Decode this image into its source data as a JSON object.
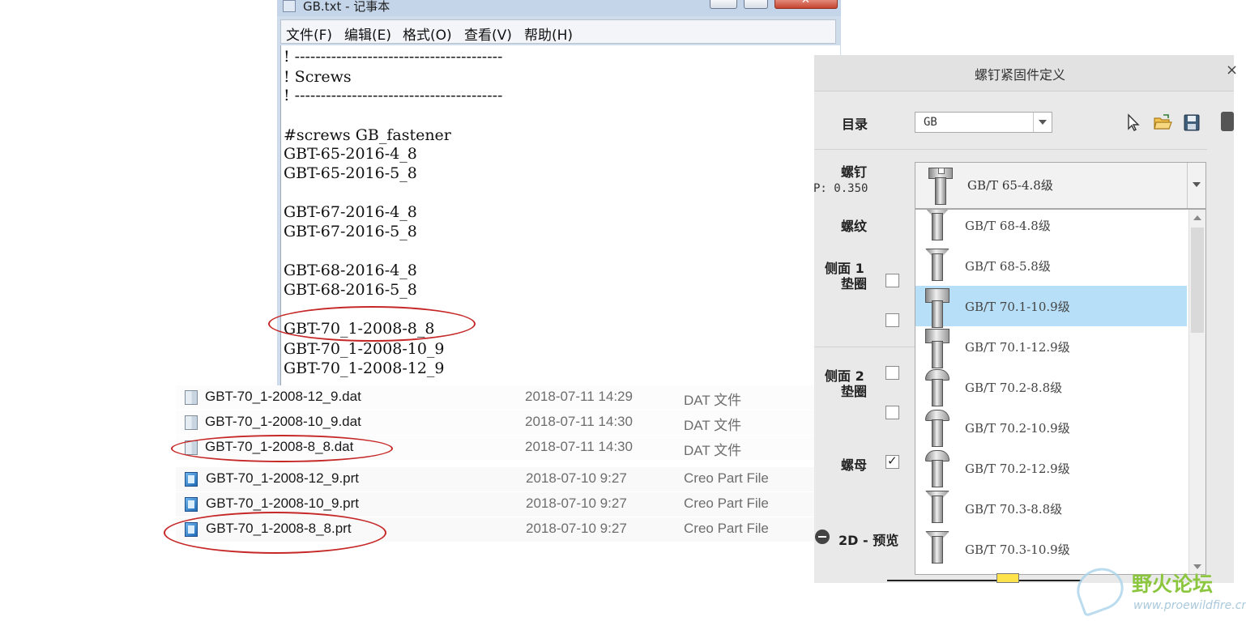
{
  "notepad": {
    "title": "GB.txt - 记事本",
    "menu": [
      "文件(F)",
      "编辑(E)",
      "格式(O)",
      "查看(V)",
      "帮助(H)"
    ],
    "lines": [
      "! ----------------------------------------",
      "! Screws",
      "! ----------------------------------------",
      "",
      "#screws GB_fastener",
      "GBT-65-2016-4_8",
      "GBT-65-2016-5_8",
      "",
      "GBT-67-2016-4_8",
      "GBT-67-2016-5_8",
      "",
      "GBT-68-2016-4_8",
      "GBT-68-2016-5_8",
      "",
      "GBT-70_1-2008-8_8",
      "GBT-70_1-2008-10_9",
      "GBT-70_1-2008-12_9"
    ]
  },
  "explorer": {
    "files": [
      {
        "name": "GBT-70_1-2008-12_9.dat",
        "date": "2018-07-11 14:29",
        "type": "DAT 文件",
        "icon": "dat-file-icon"
      },
      {
        "name": "GBT-70_1-2008-10_9.dat",
        "date": "2018-07-11 14:30",
        "type": "DAT 文件",
        "icon": "dat-file-icon"
      },
      {
        "name": "GBT-70_1-2008-8_8.dat",
        "date": "2018-07-11 14:30",
        "type": "DAT 文件",
        "icon": "dat-file-icon"
      },
      {
        "name": "GBT-70_1-2008-12_9.prt",
        "date": "2018-07-10 9:27",
        "type": "Creo Part File",
        "icon": "creo-part-icon"
      },
      {
        "name": "GBT-70_1-2008-10_9.prt",
        "date": "2018-07-10 9:27",
        "type": "Creo Part File",
        "icon": "creo-part-icon"
      },
      {
        "name": "GBT-70_1-2008-8_8.prt",
        "date": "2018-07-10 9:27",
        "type": "Creo Part File",
        "icon": "creo-part-icon"
      }
    ]
  },
  "dialog": {
    "title": "螺钉紧固件定义",
    "close": "×",
    "catalog_label": "目录",
    "catalog_value": "GB",
    "screw_label": "螺钉",
    "screw_sub": "P: 0.350",
    "thread_label": "螺纹",
    "side1_label_a": "侧面 1",
    "side1_label_b": "垫圈",
    "side2_label_a": "侧面 2",
    "side2_label_b": "垫圈",
    "nut_label": "螺母",
    "nut_checked": true,
    "preview_label": "2D - 预览",
    "selected_screw": "GB/T 65-4.8级",
    "screw_options": [
      "GB/T 68-4.8级",
      "GB/T 68-5.8级",
      "GB/T 70.1-10.9级",
      "GB/T 70.1-12.9级",
      "GB/T 70.2-8.8级",
      "GB/T 70.2-10.9级",
      "GB/T 70.2-12.9级",
      "GB/T 70.3-8.8级",
      "GB/T 70.3-10.9级"
    ],
    "highlighted_option": "GB/T 70.1-10.9级",
    "tools": [
      "cursor-select-icon",
      "open-folder-icon",
      "save-icon"
    ]
  },
  "watermark": {
    "text": "野火论坛",
    "url": "www.proewildfire.cn"
  }
}
